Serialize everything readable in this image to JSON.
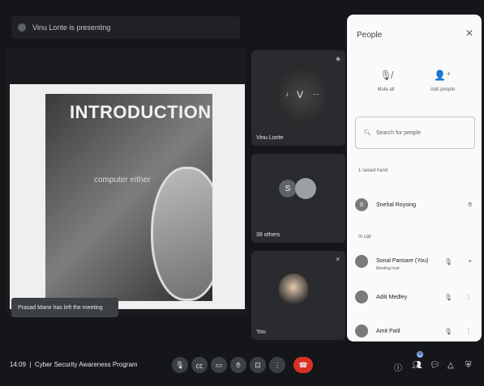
{
  "presenting_bar": {
    "text": "Vinu Lonte is presenting"
  },
  "slide": {
    "title": "INTRODUCTION",
    "body_text": "computer either"
  },
  "toast": {
    "text": "Prasad Mane has left the meeting"
  },
  "tiles": [
    {
      "name": "Vinu Lonte",
      "initials": "V"
    },
    {
      "name": "39 others",
      "initials": "S"
    },
    {
      "name": "You"
    }
  ],
  "people_panel": {
    "title": "People",
    "mute_all_label": "Mute all",
    "add_people_label": "Add people",
    "search_placeholder": "Search for people",
    "raised_hand_section": "1 raised hand",
    "in_call_section": "In call",
    "raised": [
      {
        "initial": "S",
        "name": "Snehal Roysing"
      }
    ],
    "in_call": [
      {
        "name": "Sonal Pansare (You)",
        "sub": "Meeting host"
      },
      {
        "name": "Aditi Medley"
      },
      {
        "name": "Amit Patil"
      }
    ]
  },
  "bottom_bar": {
    "clock": "14:09",
    "meeting_title": "Cyber Security Awareness Program",
    "participants_badge": "40"
  },
  "colors": {
    "end_call": "#d93025",
    "panel_bg": "#fafafa",
    "background": "#14161a"
  },
  "icons": [
    "mic-off-icon",
    "captions-icon",
    "present-icon",
    "raise-hand-icon",
    "activities-icon",
    "more-icon",
    "end-call-icon",
    "info-icon",
    "people-icon",
    "chat-icon",
    "shapes-icon",
    "lock-icon"
  ]
}
